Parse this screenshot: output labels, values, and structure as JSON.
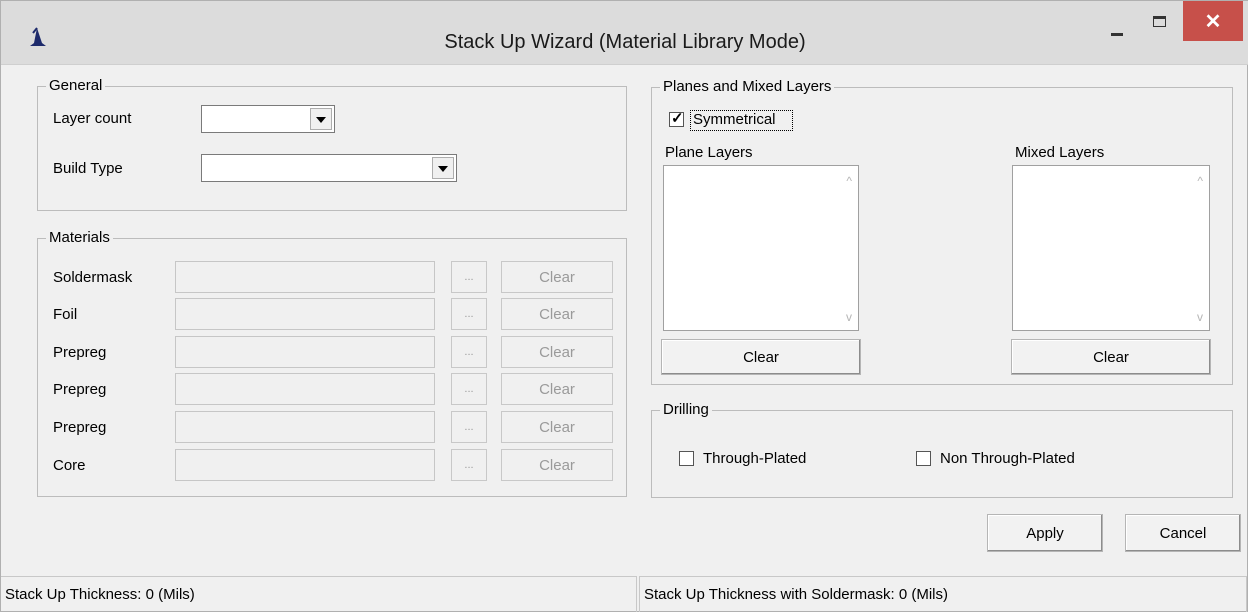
{
  "window": {
    "title": "Stack Up Wizard (Material Library Mode)",
    "icon": "wizard-hat-icon",
    "close_glyph": "✕"
  },
  "general": {
    "group_label": "General",
    "layer_count_label": "Layer count",
    "layer_count_value": "",
    "build_type_label": "Build Type",
    "build_type_value": ""
  },
  "materials": {
    "group_label": "Materials",
    "rows": [
      {
        "label": "Soldermask",
        "value": "",
        "browse": "...",
        "clear": "Clear"
      },
      {
        "label": "Foil",
        "value": "",
        "browse": "...",
        "clear": "Clear"
      },
      {
        "label": "Prepreg",
        "value": "",
        "browse": "...",
        "clear": "Clear"
      },
      {
        "label": "Prepreg",
        "value": "",
        "browse": "...",
        "clear": "Clear"
      },
      {
        "label": "Prepreg",
        "value": "",
        "browse": "...",
        "clear": "Clear"
      },
      {
        "label": "Core",
        "value": "",
        "browse": "...",
        "clear": "Clear"
      }
    ]
  },
  "planes": {
    "group_label": "Planes and Mixed Layers",
    "symmetrical_label": "Symmetrical",
    "symmetrical_checked": true,
    "plane_layers_label": "Plane Layers",
    "mixed_layers_label": "Mixed Layers",
    "plane_clear": "Clear",
    "mixed_clear": "Clear"
  },
  "drilling": {
    "group_label": "Drilling",
    "through_plated_label": "Through-Plated",
    "through_plated_checked": false,
    "non_through_plated_label": "Non Through-Plated",
    "non_through_plated_checked": false
  },
  "actions": {
    "apply": "Apply",
    "cancel": "Cancel"
  },
  "status": {
    "thickness": "Stack Up Thickness: 0 (Mils)",
    "thickness_with_soldermask": "Stack Up Thickness with Soldermask: 0 (Mils)"
  }
}
